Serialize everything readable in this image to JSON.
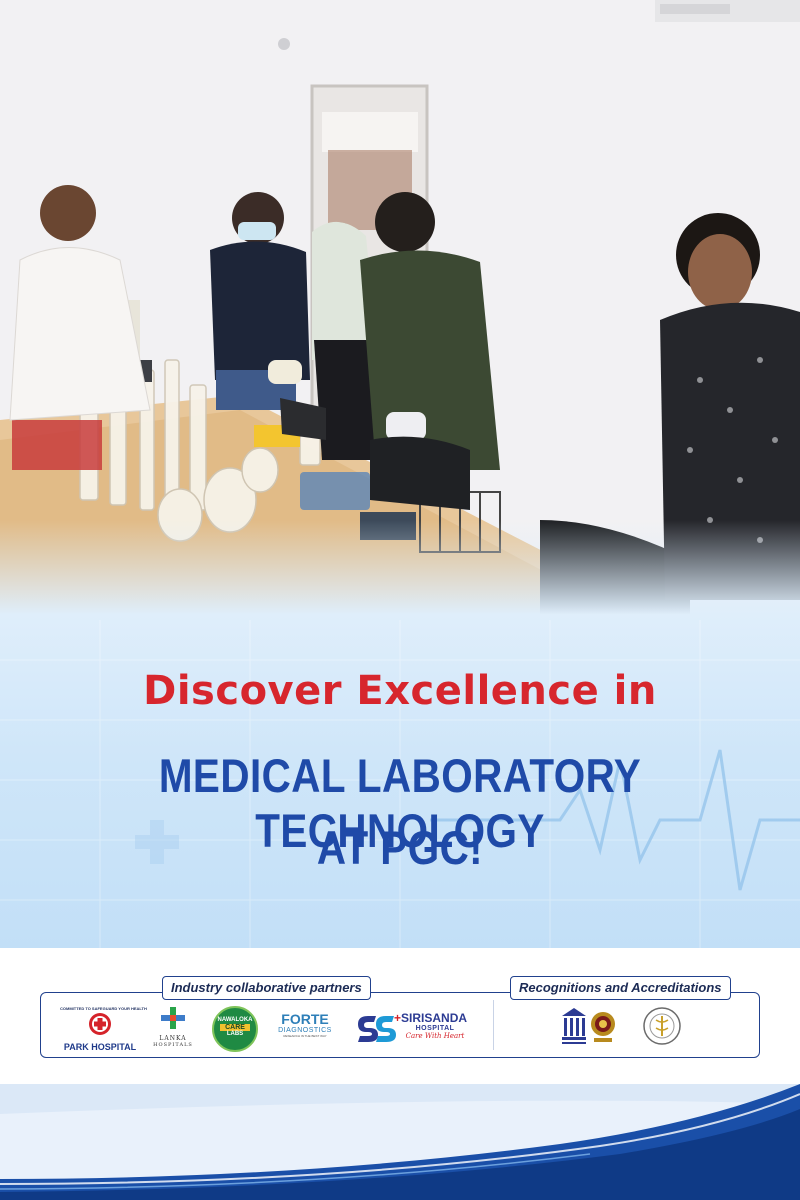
{
  "headline": {
    "line1": "Discover Excellence in",
    "line2": "MEDICAL LABORATORY TECHNOLOGY",
    "line3": "AT PGC!"
  },
  "partners": {
    "label": "Industry collaborative partners",
    "park_hospital": {
      "tagline": "COMMITTED TO SAFEGUARD YOUR HEALTH",
      "name": "PARK HOSPITAL"
    },
    "lanka_hospitals": {
      "name": "LANKA",
      "sub": "HOSPITALS"
    },
    "nawaloka": {
      "top": "NAWALOKA",
      "mid": "CARE",
      "bottom": "LABS"
    },
    "forte": {
      "name": "FORTE",
      "sub": "DIAGNOSTICS",
      "tag": "RESEARCH IN THE BEST WAY"
    },
    "sirisanda": {
      "name": "SIRISANDA",
      "sub": "HOSPITAL",
      "tag": "Care With Heart"
    }
  },
  "accreditations": {
    "label": "Recognitions and Accreditations"
  },
  "colors": {
    "headline_red": "#d7262d",
    "headline_blue": "#1f4aa8",
    "border_navy": "#21418d"
  }
}
